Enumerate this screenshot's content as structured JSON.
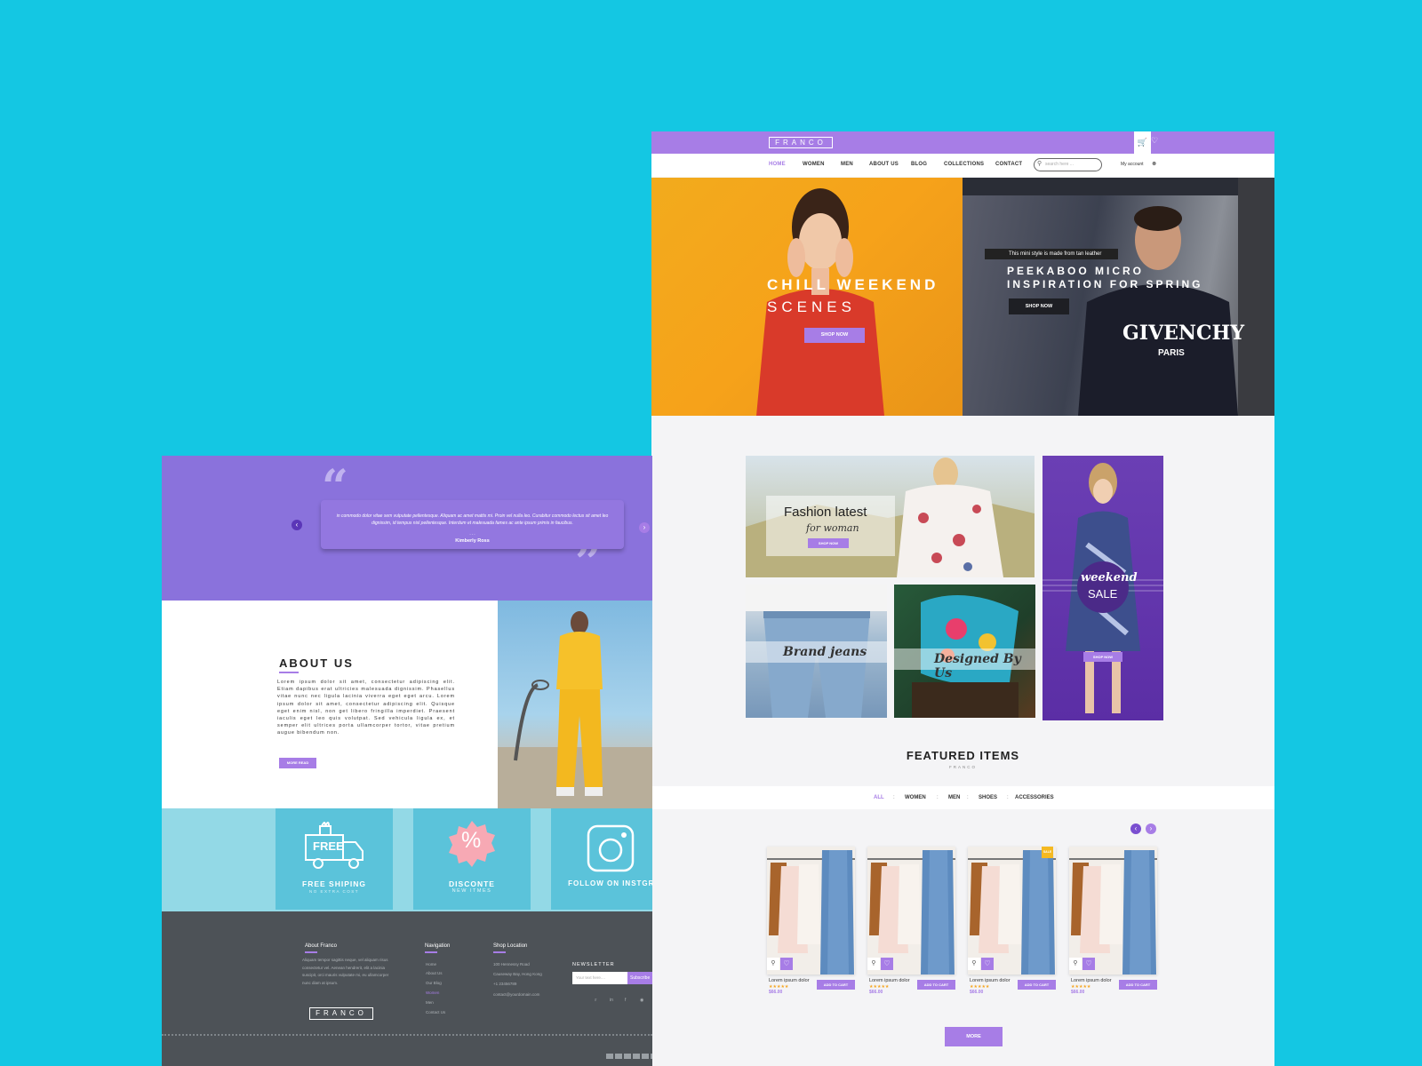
{
  "brand": {
    "logo": "FRANCO",
    "accent": "#a77de6",
    "background": "#14c7e3"
  },
  "header": {
    "nav": [
      "HOME",
      "WOMEN",
      "MEN",
      "ABOUT US",
      "BLOG",
      "COLLECTIONS",
      "CONTACT"
    ],
    "search_placeholder": "search here ...",
    "account": "My account",
    "icons": [
      "cart-icon",
      "heart-icon",
      "user-icon",
      "search-icon"
    ]
  },
  "hero": {
    "left": {
      "line1": "CHILL WEEKEND",
      "line2": "SCENES",
      "button": "SHOP NOW"
    },
    "right": {
      "tag": "This mini style is made from tan leather",
      "line1": "PEEKABOO MICRO",
      "line2": "INSPIRATION FOR SPRING",
      "button": "SHOP NOW",
      "shirt1": "GIVENCHY",
      "shirt2": "PARIS"
    }
  },
  "promos": {
    "fashion": {
      "title": "Fashion latest",
      "script": "for woman",
      "button": "SHOP NOW"
    },
    "jeans": "Brand jeans",
    "designed": "Designed By Us",
    "sale": {
      "script": "weekend",
      "word": "SALE",
      "button": "SHOP NOW"
    }
  },
  "featured": {
    "title": "FEATURED ITEMS",
    "subtitle": "FRANCO",
    "filters": [
      "ALL",
      "WOMEN",
      "MEN",
      "SHOES",
      "ACCESSORIES"
    ],
    "products": [
      {
        "name": "Lorem ipsum dolor",
        "price": "$66.00",
        "stars": "★★★★★",
        "button": "ADD TO CART"
      },
      {
        "name": "Lorem ipsum dolor",
        "price": "$66.00",
        "stars": "★★★★★",
        "button": "ADD TO CART"
      },
      {
        "name": "Lorem ipsum dolor",
        "price": "$66.00",
        "stars": "★★★★★",
        "button": "ADD TO CART",
        "badge": "SALE"
      },
      {
        "name": "Lorem ipsum dolor",
        "price": "$66.00",
        "stars": "★★★★★",
        "button": "ADD TO CART"
      }
    ],
    "more": "MORE"
  },
  "testimonial": {
    "text": "in commodo dolor vitae sem vulputate pellentesque. Aliquam ac amet mattis mi. Proin vel nulla leo. Curabitur commodo lectus sit amet leo dignissim, id tempus nisl pellentesque. Interdum et malesuada fames ac ante ipsum primis in faucibus.",
    "separator": "- - -",
    "name": "Kimberly Ross"
  },
  "about": {
    "title": "ABOUT US",
    "text": "Lorem ipsum dolor sit amet, consectetur adipiscing elit. Etiam dapibus erat ultricies malesuada dignissim. Phasellus vitae nunc nec ligula lacinia viverra eget eget arcu. Lorem ipsum dolor sit amet, consectetur adipiscing elit. Quisque eget enim nisl, non get libero fringilla imperdiet. Praesent iaculis eget leo quis volutpat. Sed vehicula ligula ex, et semper elit ultrices porta ullamcorper tortor, vitae pretium augue bibendum non.",
    "button": "MORE READ"
  },
  "features": [
    {
      "title": "FREE SHIPING",
      "sub": "NO EXTRA COST",
      "icon": "truck-icon",
      "badge": "FREE"
    },
    {
      "title": "DISCONTE",
      "sub": "NEW ITMES",
      "icon": "percent-icon",
      "badge": "%"
    },
    {
      "title": "FOLLOW ON INSTGRAM",
      "sub": "",
      "icon": "instagram-icon"
    }
  ],
  "footer": {
    "about_title": "About Franco",
    "about_text": "Aliquam tempor sagittis neque, vel aliquam risus consectetur vel. Aenean hendrerit, elit a lacinia suscipit, orci mauris vulputate mi, eu ullamcorper nunc diam at ipsum.",
    "nav_title": "Navigation",
    "nav_items": [
      "Home",
      "About Us",
      "Our Blog",
      "Women",
      "Men",
      "Contact Us"
    ],
    "shop_title": "Shop Location",
    "shop_items": [
      "100 Hennessy Road",
      "Causeway Bay, Hong Kong",
      "+1 23456789",
      "contact@yourdomain.com"
    ],
    "newsletter_title": "NEWSLETTER",
    "newsletter_placeholder": "Your text here....",
    "newsletter_button": "Subscribe",
    "logo": "FRANCO",
    "social": [
      "twitter-icon",
      "linkedin-icon",
      "facebook-icon",
      "instagram-icon"
    ]
  }
}
